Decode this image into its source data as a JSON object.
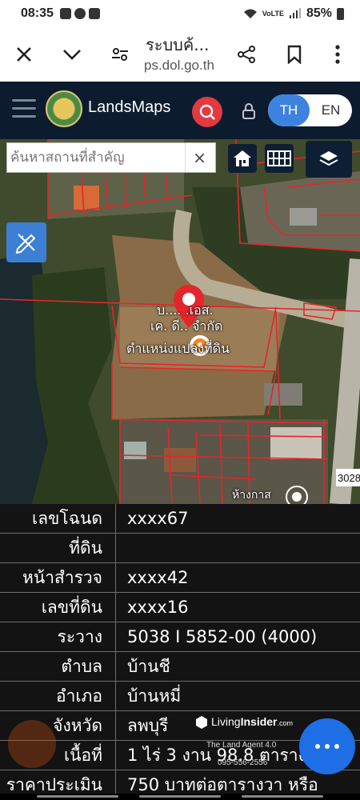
{
  "status": {
    "time": "08:35",
    "battery": "85%",
    "network": "VoLTE"
  },
  "browser": {
    "title": "ระบบค้...",
    "url": "ps.dol.go.th",
    "icons": [
      "close-icon",
      "chevron-down-icon",
      "tune-icon",
      "share-icon",
      "bookmark-icon",
      "more-vert-icon"
    ]
  },
  "header": {
    "brand": "LandsMaps",
    "lang_th": "TH",
    "lang_en": "EN",
    "active_lang": "TH"
  },
  "map": {
    "search_placeholder": "ค้นหาสถานที่สำคัญ",
    "clear": "×",
    "place_label_1": "บ.... .เอส.",
    "place_label_2": "เค. ดี.. จำกัด",
    "parcel_label": "ตำแหน่งแปลงที่ดิน",
    "road_number": "3028",
    "lower_label": "ห้างกาส"
  },
  "parcel_info": [
    {
      "key": "เลขโฉนด",
      "value": "xxxx67"
    },
    {
      "key": "ที่ดิน",
      "value": ""
    },
    {
      "key": "หน้าสำรวจ",
      "value": "xxxx42"
    },
    {
      "key": "เลขที่ดิน",
      "value": "xxxx16"
    },
    {
      "key": "ระวาง",
      "value": "5038 I 5852-00 (4000)"
    },
    {
      "key": "ตำบล",
      "value": "บ้านชี"
    },
    {
      "key": "อำเภอ",
      "value": "บ้านหมี่"
    },
    {
      "key": "จังหวัด",
      "value": "ลพบุรี"
    },
    {
      "key": "เนื้อที่",
      "value": "1 ไร่ 3 งาน 98.8 ตารางวา"
    },
    {
      "key": "ราคาประเมิน",
      "value": "750 บาทต่อตารางวา หรือ"
    }
  ],
  "watermark": {
    "brand_a": "Living",
    "brand_b": "Insider",
    "brand_c": ".com",
    "sub": "The Land Agent 4.0",
    "phone": "095-556-2556"
  },
  "colors": {
    "header_bg": "#0d1b2e",
    "search_red": "#e23a40",
    "lang_blue": "#3e82e0",
    "parcel_line": "#e4262c",
    "fab_blue": "#1e6fe6"
  }
}
